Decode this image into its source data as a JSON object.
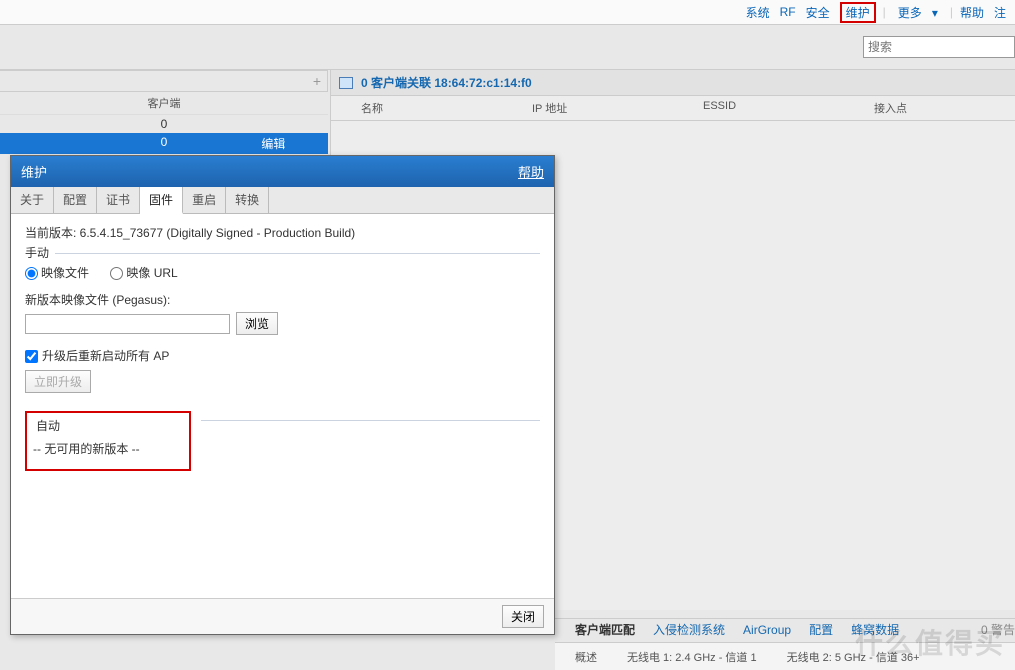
{
  "top_menu": {
    "system": "系统",
    "rf": "RF",
    "security": "安全",
    "maintenance": "维护",
    "more": "更多",
    "help": "帮助",
    "logout": "注"
  },
  "search": {
    "placeholder": "搜索"
  },
  "left": {
    "col_client": "客户端",
    "row0": "0",
    "sel_val": "0",
    "sel_edit": "编辑"
  },
  "right": {
    "title": "0 客户端关联 18:64:72:c1:14:f0",
    "col_name": "名称",
    "col_ip": "IP 地址",
    "col_essid": "ESSID",
    "col_ap": "接入点"
  },
  "dialog": {
    "title": "维护",
    "help": "帮助",
    "tabs": {
      "about": "关于",
      "config": "配置",
      "cert": "证书",
      "firmware": "固件",
      "reboot": "重启",
      "convert": "转换"
    },
    "version_line": "当前版本: 6.5.4.15_73677 (Digitally Signed - Production Build)",
    "manual_legend": "手动",
    "radio_file": "映像文件",
    "radio_url": "映像 URL",
    "file_label": "新版本映像文件 (Pegasus):",
    "browse": "浏览",
    "reboot_chk": "升级后重新启动所有 AP",
    "upgrade_now": "立即升级",
    "auto_legend": "自动",
    "no_version": "-- 无可用的新版本 --",
    "close": "关闭"
  },
  "bottom_tabs": {
    "client_match": "客户端匹配",
    "ids": "入侵检测系统",
    "airgroup": "AirGroup",
    "config": "配置",
    "hive": "蜂窝数据",
    "alert": "0 警告"
  },
  "status": {
    "overview": "概述",
    "radio1": "无线电 1: 2.4 GHz - 信道 1",
    "radio2": "无线电 2: 5 GHz - 信道 36+"
  },
  "watermark": "什么值得买"
}
